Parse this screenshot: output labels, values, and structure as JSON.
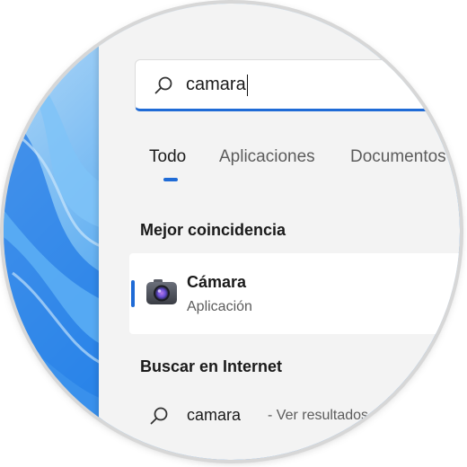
{
  "search": {
    "query": "camara"
  },
  "tabs": [
    {
      "label": "Todo",
      "active": true
    },
    {
      "label": "Aplicaciones",
      "active": false
    },
    {
      "label": "Documentos",
      "active": false
    }
  ],
  "best_match": {
    "section_title": "Mejor coincidencia",
    "app_name": "Cámara",
    "app_type": "Aplicación",
    "icon": "camera-icon"
  },
  "web": {
    "section_title": "Buscar en Internet",
    "query": "camara",
    "hint": "- Ver resultados web",
    "icon": "search-icon"
  },
  "colors": {
    "accent": "#1f6bd6",
    "panel_bg": "#f3f3f3",
    "wallpaper": "#2b7de0"
  }
}
